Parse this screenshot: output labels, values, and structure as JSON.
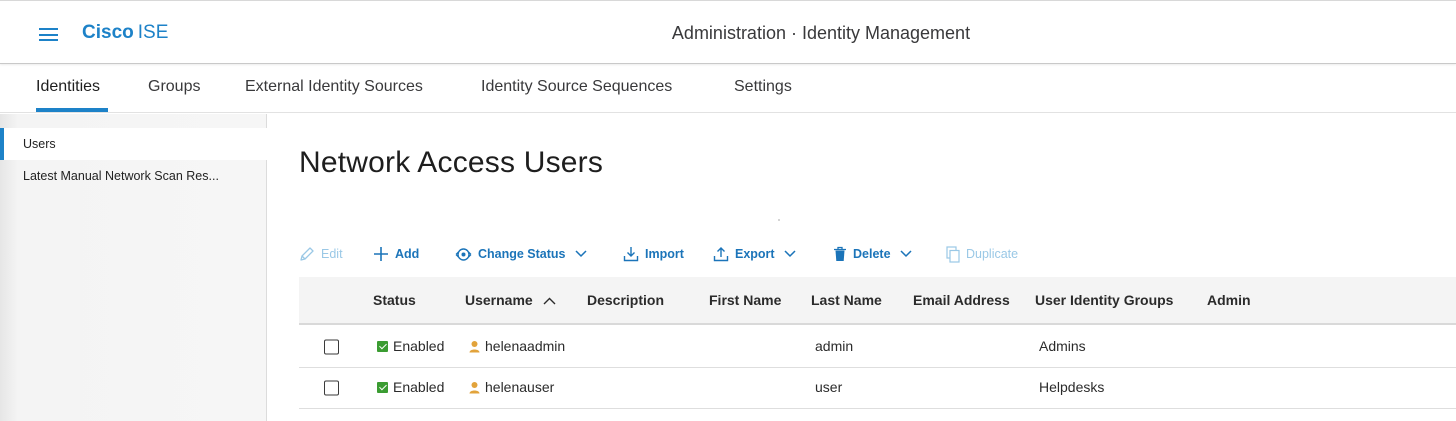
{
  "header": {
    "brand_bold": "Cisco",
    "brand_light": "ISE",
    "title": "Administration · Identity Management"
  },
  "tabs": [
    {
      "label": "Identities",
      "active": true
    },
    {
      "label": "Groups",
      "active": false
    },
    {
      "label": "External Identity Sources",
      "active": false
    },
    {
      "label": "Identity Source Sequences",
      "active": false
    },
    {
      "label": "Settings",
      "active": false
    }
  ],
  "sidebar": {
    "items": [
      {
        "label": "Users",
        "active": true
      },
      {
        "label": "Latest Manual Network Scan Res...",
        "active": false
      }
    ]
  },
  "main": {
    "title": "Network Access Users"
  },
  "toolbar": {
    "edit": "Edit",
    "add": "Add",
    "change_status": "Change Status",
    "import": "Import",
    "export": "Export",
    "delete": "Delete",
    "duplicate": "Duplicate"
  },
  "table": {
    "columns": [
      "Status",
      "Username",
      "Description",
      "First Name",
      "Last Name",
      "Email Address",
      "User Identity Groups",
      "Admin"
    ],
    "sorted_column": "Username",
    "sort_direction": "ascending",
    "rows": [
      {
        "status": "Enabled",
        "username": "helenaadmin",
        "description": "",
        "first_name": "",
        "last_name": "admin",
        "email": "",
        "groups": "Admins",
        "admin": ""
      },
      {
        "status": "Enabled",
        "username": "helenauser",
        "description": "",
        "first_name": "",
        "last_name": "user",
        "email": "",
        "groups": "Helpdesks",
        "admin": ""
      }
    ]
  },
  "colors": {
    "accent": "#1d82c8",
    "link": "#1b74b9",
    "disabled_link": "#9ac8e6",
    "status_enabled": "#3b9c32",
    "user_icon": "#e2a33b"
  }
}
